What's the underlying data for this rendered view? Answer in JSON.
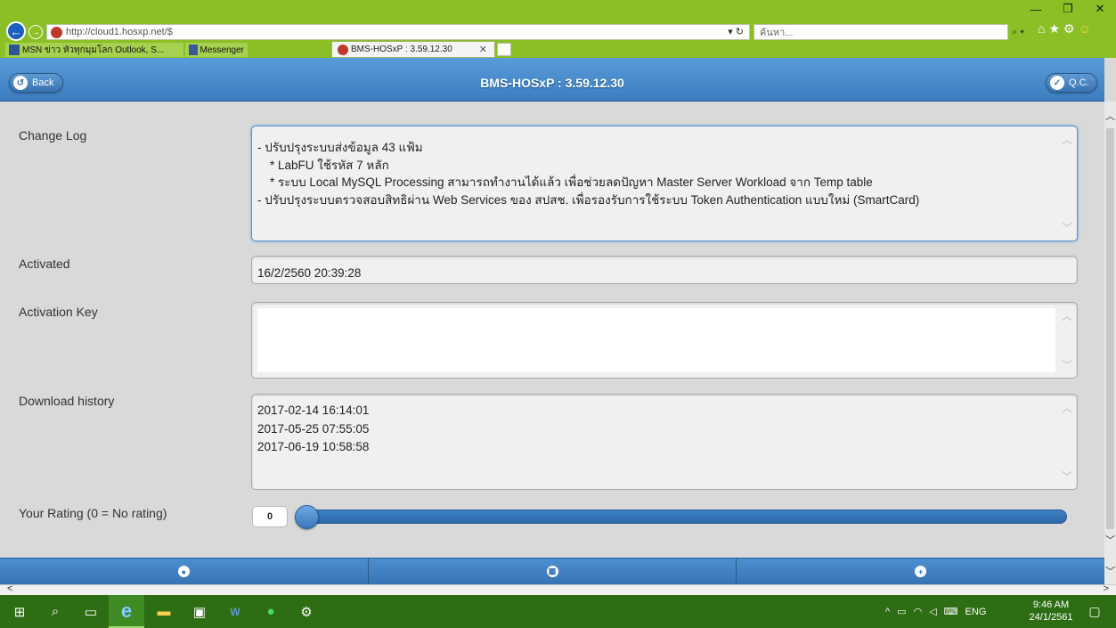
{
  "browser": {
    "url": "http://cloud1.hosxp.net/$",
    "search_placeholder": "ค้นหา...",
    "favorites": [
      "MSN ข่าว หัวทุกมุมโลก Outlook, S...",
      "Messenger"
    ],
    "active_tab": "BMS-HOSxP : 3.59.12.30",
    "window_controls": {
      "minimize": "—",
      "restore": "❐",
      "close": "✕"
    }
  },
  "header": {
    "back_label": "Back",
    "title": "BMS-HOSxP : 3.59.12.30",
    "qc_label": "Q.C."
  },
  "form": {
    "change_log": {
      "label": "Change Log",
      "lines": [
        "- ปรับปรุงระบบส่งข้อมูล 43 แฟ้ม",
        "* LabFU ใช้รหัส 7 หลัก",
        "* ระบบ Local MySQL Processing สามารถทำงานได้แล้ว เพื่อช่วยลดปัญหา Master Server Workload จาก Temp table",
        "- ปรับปรุงระบบตรวจสอบสิทธิผ่าน Web Services ของ สปสช. เพื่อรองรับการใช้ระบบ Token Authentication แบบใหม่ (SmartCard)"
      ]
    },
    "activated": {
      "label": "Activated",
      "value": "16/2/2560 20:39:28"
    },
    "activation_key": {
      "label": "Activation Key",
      "value": ""
    },
    "download_history": {
      "label": "Download history",
      "entries": [
        "2017-02-14  16:14:01",
        "2017-05-25  07:55:05",
        "2017-06-19  10:58:58"
      ]
    },
    "rating": {
      "label": "Your Rating (0 = No rating)",
      "value": "0",
      "fraction": 0
    }
  },
  "taskbar": {
    "time": "9:46 AM",
    "date": "24/1/2561",
    "language": "ENG"
  },
  "colors": {
    "browser_chrome": "#8cbf26",
    "header_blue": "#3b7dc0",
    "taskbar": "#2d6e14"
  }
}
